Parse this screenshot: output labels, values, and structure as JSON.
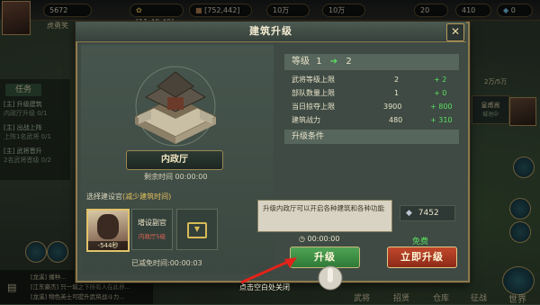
{
  "hud": {
    "player_name": "虎勇笑",
    "power": "5672",
    "food": "[11:40:49]",
    "wood": "[752,442]",
    "iron": "10万",
    "stone": "10万",
    "gold": "20",
    "coins": "410",
    "diamonds": "0"
  },
  "quest": {
    "header": "任务",
    "items": [
      {
        "title": "[主] 升级建筑",
        "desc": "内政厅升级 0/1"
      },
      {
        "title": "[主] 出战上阵",
        "desc": "上阵1名武将 0/1"
      },
      {
        "title": "[主] 武将晋升",
        "desc": "2名武将晋级 0/2"
      }
    ]
  },
  "chat": [
    {
      "text": "[龙溪] 播种..."
    },
    {
      "text": "[江东豪杰] 只一城之下所有人在此界..."
    },
    {
      "text": "[龙溪] 物色英士可提升武将战斗力..."
    }
  ],
  "right_hud": {
    "stat": "2万/5万",
    "npc_name": "皇甫嵩",
    "npc_status": "城池中"
  },
  "bottom_nav": [
    "武将",
    "招贤",
    "仓库",
    "征战",
    "世界"
  ],
  "tap_hint": "点击空白处关闭",
  "dialog": {
    "title": "建筑升级",
    "close_icon": "✕",
    "building_name": "内政厅",
    "remaining_label": "剩余时间",
    "remaining_value": "00:00:00",
    "select_label": "选择建设官",
    "select_hint": "(减少建筑时间)",
    "officer_time": "-544秒",
    "add_officer": "增设副官",
    "add_officer_sub": "内政厅5级",
    "saved_label": "已减免时间",
    "saved_value": "00:00:03",
    "level_label": "等级",
    "level_from": "1",
    "level_to": "2",
    "stats": [
      {
        "name": "武将等级上限",
        "value": "2",
        "delta": "+ 2"
      },
      {
        "name": "部队数量上限",
        "value": "1",
        "delta": "+ 0"
      },
      {
        "name": "当日掠夺上限",
        "value": "3900",
        "delta": "+ 800"
      },
      {
        "name": "建筑战力",
        "value": "480",
        "delta": "+ 310"
      }
    ],
    "conditions_label": "升级条件",
    "tooltip": "升级内政厅可以开启各种建筑和各种功能",
    "cost_value": "7452",
    "upgrade_time": "00:00:00",
    "free_label": "免费",
    "upgrade_button": "升级",
    "instant_button": "立即升级"
  }
}
